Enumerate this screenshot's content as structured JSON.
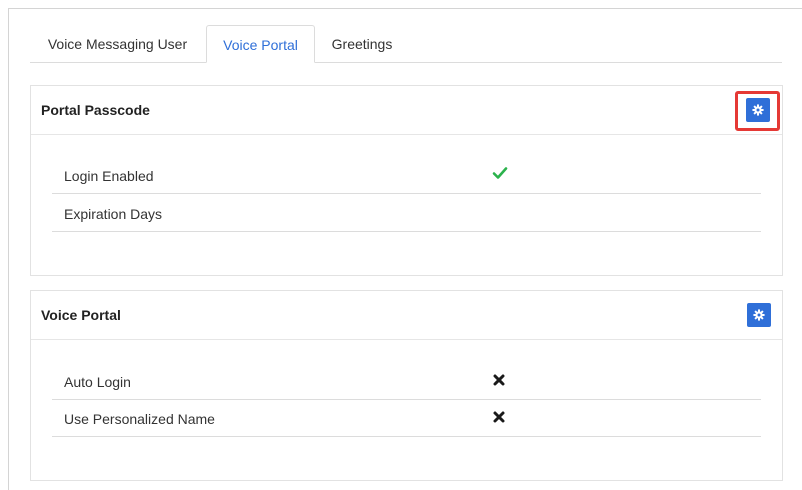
{
  "tabs": [
    {
      "label": "Voice Messaging User",
      "active": false
    },
    {
      "label": "Voice Portal",
      "active": true
    },
    {
      "label": "Greetings",
      "active": false
    }
  ],
  "panels": [
    {
      "title": "Portal Passcode",
      "settings_icon": "gear-icon",
      "rows": [
        {
          "label": "Login Enabled",
          "value_icon": "check-icon"
        },
        {
          "label": "Expiration Days",
          "value": ""
        }
      ]
    },
    {
      "title": "Voice Portal",
      "settings_icon": "gear-icon",
      "rows": [
        {
          "label": "Auto Login",
          "value_icon": "x-icon"
        },
        {
          "label": "Use Personalized Name",
          "value_icon": "x-icon"
        }
      ]
    }
  ],
  "colors": {
    "accent": "#2f6fd8",
    "check": "#2bb24c",
    "highlight": "#e53935"
  }
}
